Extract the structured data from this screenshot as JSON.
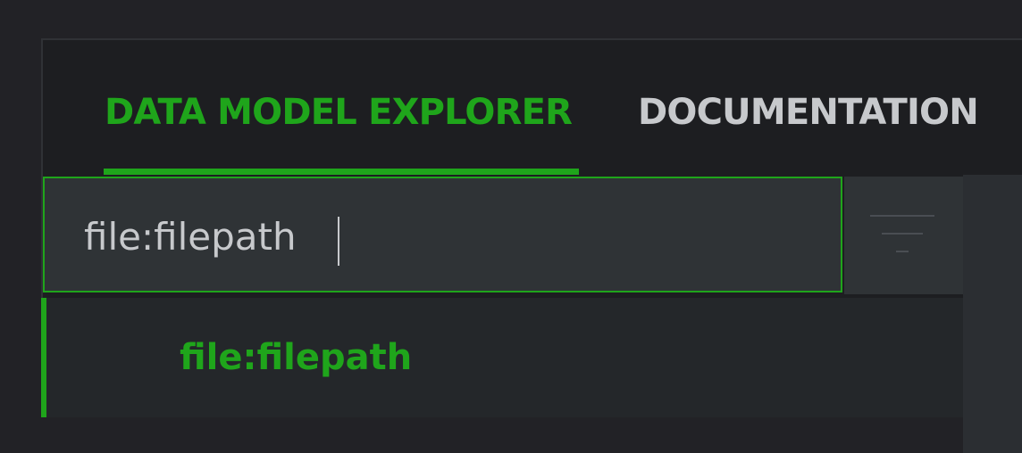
{
  "tabs": [
    {
      "label": "DATA MODEL EXPLORER",
      "active": true
    },
    {
      "label": "DOCUMENTATION",
      "active": false
    }
  ],
  "search": {
    "value": "file:filepath",
    "placeholder": ""
  },
  "filter": {
    "icon": "filter-icon"
  },
  "results": [
    {
      "label": "file:filepath"
    }
  ],
  "colors": {
    "accent": "#1fa51b",
    "background": "#222226",
    "panel": "#1d1e21",
    "input": "#2f3336",
    "text": "#c7c9cc"
  }
}
